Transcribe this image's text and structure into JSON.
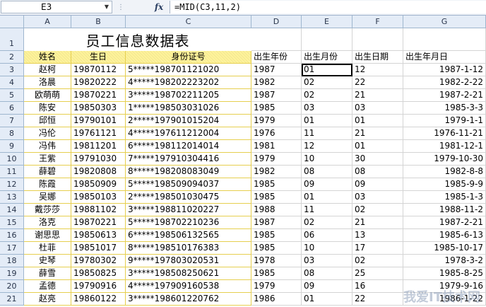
{
  "formula_bar": {
    "name_box": "E3",
    "fx_label": "fx",
    "formula": "=MID(C3,11,2)"
  },
  "columns": [
    "A",
    "B",
    "C",
    "D",
    "E",
    "F",
    "G"
  ],
  "title": "员工信息数据表",
  "headers": [
    "姓名",
    "生日",
    "身份证号",
    "出生年份",
    "出生月份",
    "出生日期",
    "出生年月日"
  ],
  "rows": [
    {
      "n": "3",
      "c": [
        "赵柯",
        "19870112",
        "5*****198701121020",
        "1987",
        "01",
        "12",
        "1987-1-12"
      ]
    },
    {
      "n": "4",
      "c": [
        "洛晨",
        "19820222",
        "4*****198202223202",
        "1982",
        "02",
        "22",
        "1982-2-22"
      ]
    },
    {
      "n": "5",
      "c": [
        "欧萌萌",
        "19870221",
        "3*****198702211205",
        "1987",
        "02",
        "21",
        "1987-2-21"
      ]
    },
    {
      "n": "6",
      "c": [
        "陈安",
        "19850303",
        "1*****198503031026",
        "1985",
        "03",
        "03",
        "1985-3-3"
      ]
    },
    {
      "n": "7",
      "c": [
        "邱恒",
        "19790101",
        "2*****197901015204",
        "1979",
        "01",
        "01",
        "1979-1-1"
      ]
    },
    {
      "n": "8",
      "c": [
        "冯伦",
        "19761121",
        "4*****197611212004",
        "1976",
        "11",
        "21",
        "1976-11-21"
      ]
    },
    {
      "n": "9",
      "c": [
        "冯伟",
        "19811201",
        "6*****198112014014",
        "1981",
        "12",
        "01",
        "1981-12-1"
      ]
    },
    {
      "n": "10",
      "c": [
        "王紫",
        "19791030",
        "7*****197910304416",
        "1979",
        "10",
        "30",
        "1979-10-30"
      ]
    },
    {
      "n": "11",
      "c": [
        "薛碧",
        "19820808",
        "8*****198208083049",
        "1982",
        "08",
        "08",
        "1982-8-8"
      ]
    },
    {
      "n": "12",
      "c": [
        "陈霞",
        "19850909",
        "5*****198509094037",
        "1985",
        "09",
        "09",
        "1985-9-9"
      ]
    },
    {
      "n": "13",
      "c": [
        "吴娜",
        "19850103",
        "2*****198501030475",
        "1985",
        "01",
        "03",
        "1985-1-3"
      ]
    },
    {
      "n": "14",
      "c": [
        "戴莎莎",
        "19881102",
        "3*****198811020227",
        "1988",
        "11",
        "02",
        "1988-11-2"
      ]
    },
    {
      "n": "15",
      "c": [
        "洛克",
        "19870221",
        "5*****198702210236",
        "1987",
        "02",
        "21",
        "1987-2-21"
      ]
    },
    {
      "n": "16",
      "c": [
        "谢思思",
        "19850613",
        "6*****198506132565",
        "1985",
        "06",
        "13",
        "1985-6-13"
      ]
    },
    {
      "n": "17",
      "c": [
        "杜菲",
        "19851017",
        "8*****198510176383",
        "1985",
        "10",
        "17",
        "1985-10-17"
      ]
    },
    {
      "n": "18",
      "c": [
        "史琴",
        "19780302",
        "9*****197803020531",
        "1978",
        "03",
        "02",
        "1978-3-2"
      ]
    },
    {
      "n": "19",
      "c": [
        "薛雪",
        "19850825",
        "3*****198508250621",
        "1985",
        "08",
        "25",
        "1985-8-25"
      ]
    },
    {
      "n": "20",
      "c": [
        "孟德",
        "19790916",
        "4*****197909160538",
        "1979",
        "09",
        "16",
        "1979-9-16"
      ]
    },
    {
      "n": "21",
      "c": [
        "赵亮",
        "19860122",
        "3*****198601220762",
        "1986",
        "01",
        "22",
        "1986-1-22"
      ]
    }
  ],
  "watermark": "我爱IT技术网"
}
